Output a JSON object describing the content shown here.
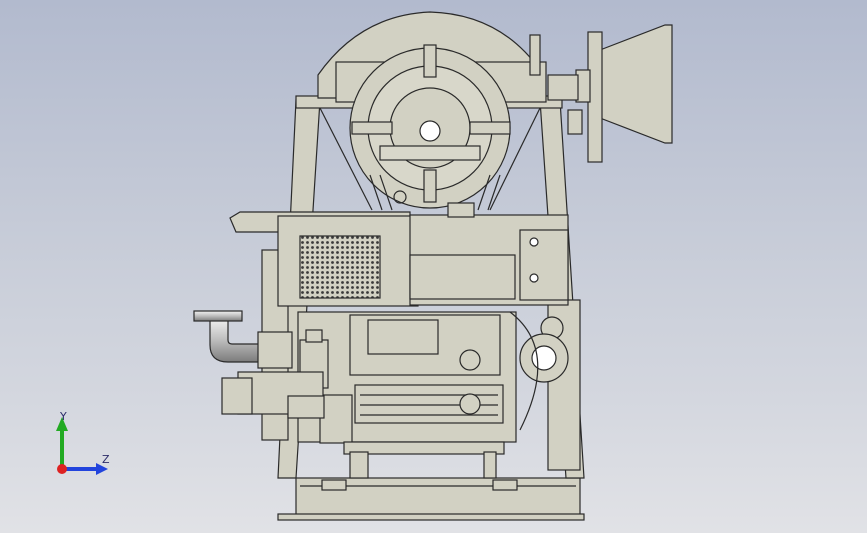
{
  "viewport": {
    "background_top": "#b2bace",
    "background_bottom": "#e1e2e6",
    "model": {
      "body_color": "#d2d1c3",
      "edge_color": "#2a2a2a",
      "pipe_color": "#c9c9c9"
    },
    "triad": {
      "y_label": "Y",
      "z_label": "Z",
      "y_color": "#22aa22",
      "z_color": "#2244dd",
      "x_color": "#dd2222"
    }
  }
}
